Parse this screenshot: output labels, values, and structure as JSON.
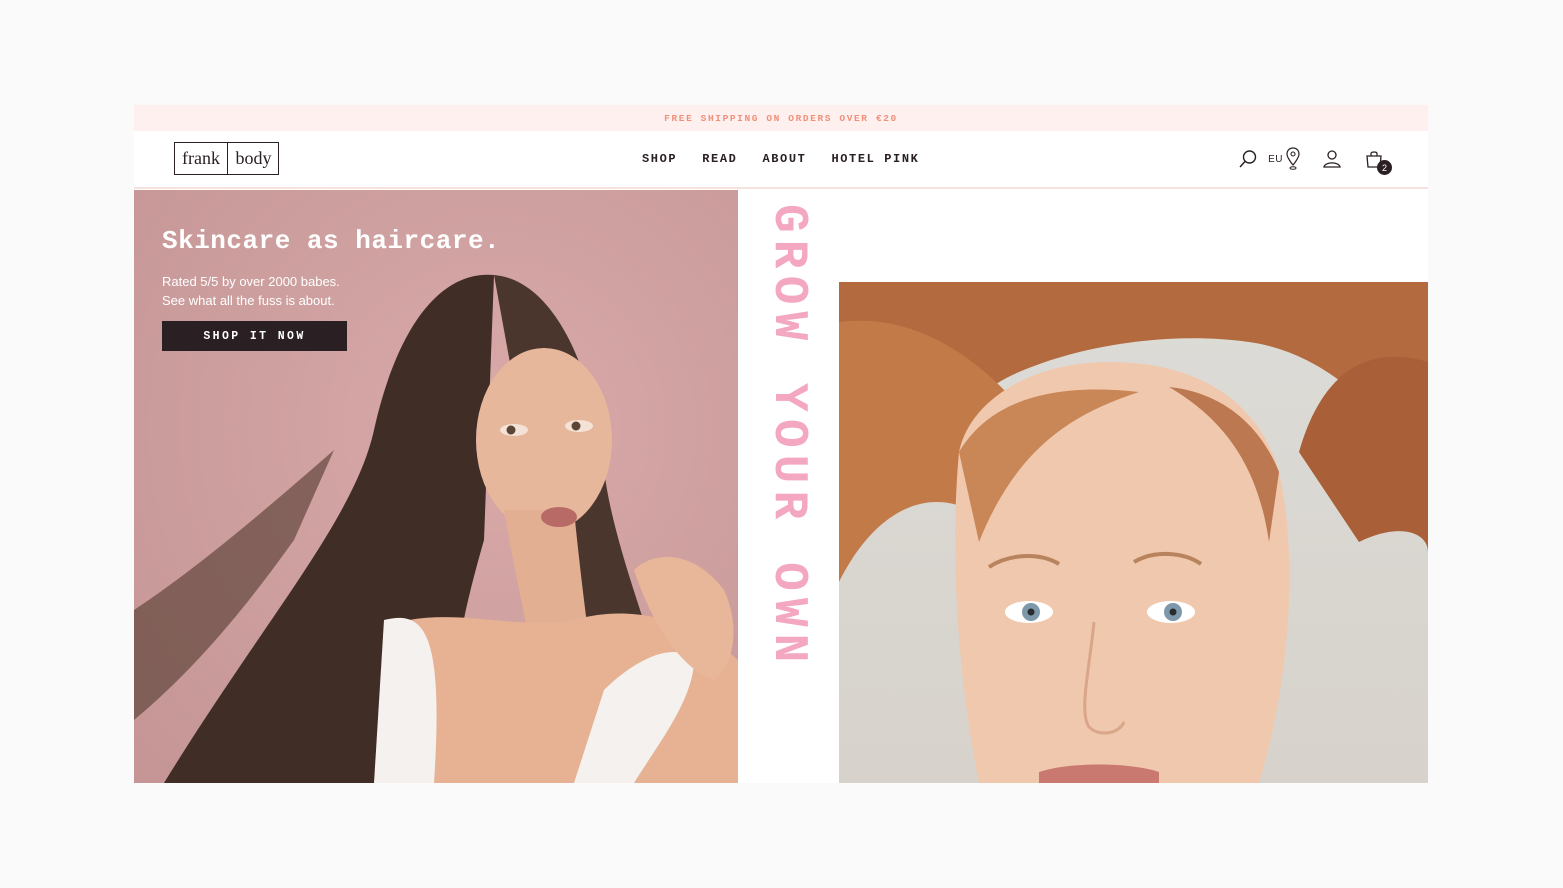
{
  "promo": {
    "text": "FREE SHIPPING ON ORDERS OVER €20"
  },
  "brand": {
    "left": "frank",
    "right": "body"
  },
  "nav": [
    "SHOP",
    "READ",
    "ABOUT",
    "HOTEL PINK"
  ],
  "header_icons": {
    "search": "search-icon",
    "region": "EU",
    "location": "location-pin-icon",
    "account": "user-icon",
    "cart": "shopping-bag-icon",
    "cart_count": "2"
  },
  "hero": {
    "title": "Skincare as haircare.",
    "subtitle_line1": "Rated 5/5 by over 2000 babes.",
    "subtitle_line2": "See what all the fuss is about.",
    "cta": "SHOP IT NOW",
    "vertical_text": "GROW YOUR OWN"
  },
  "colors": {
    "accent_pink": "#f3a7c0",
    "promo_bg": "#fdf0ee",
    "promo_text": "#f0907a",
    "dark": "#2a2023",
    "hero_bg": "#d0a2a1"
  }
}
